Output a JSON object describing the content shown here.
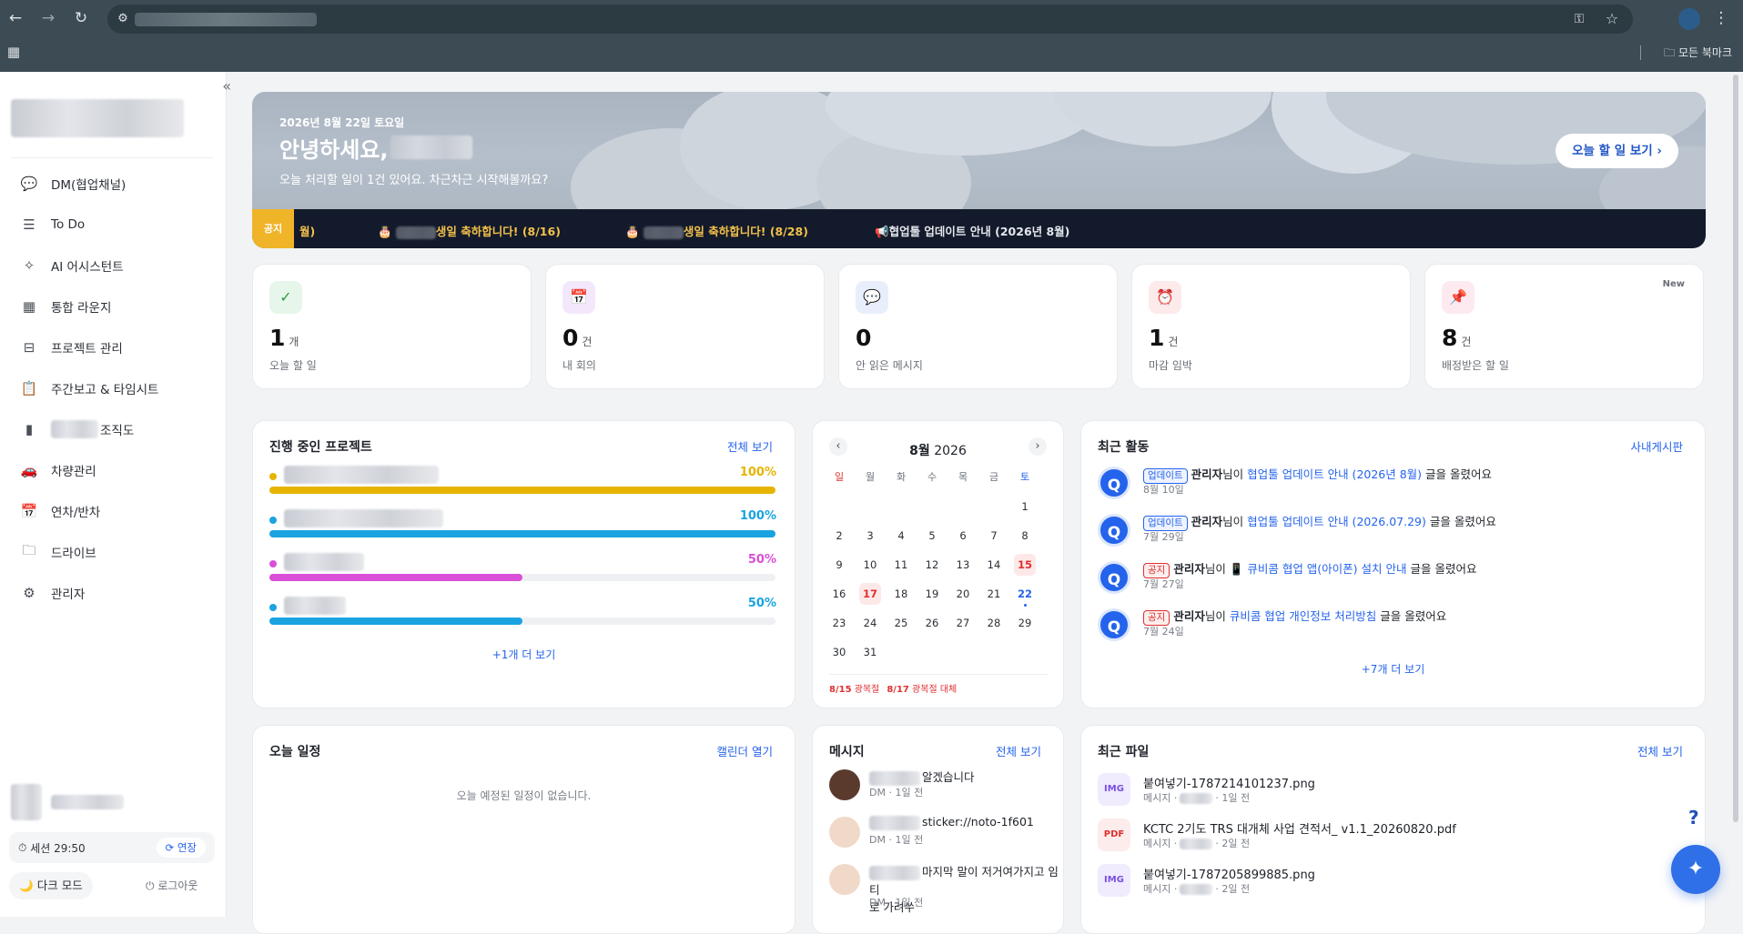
{
  "browser": {
    "bookmarks_label": "모든 북마크"
  },
  "sidebar": {
    "items": [
      {
        "label": "DM(협업채널)",
        "icon": "chat-icon"
      },
      {
        "label": "To Do",
        "icon": "list-icon"
      },
      {
        "label": "AI 어시스턴트",
        "icon": "sparkle-icon"
      },
      {
        "label": "통합 라운지",
        "icon": "grid-icon"
      },
      {
        "label": "프로젝트 관리",
        "icon": "project-icon"
      },
      {
        "label": "주간보고 & 타임시트",
        "icon": "clipboard-icon"
      },
      {
        "label": "조직도",
        "icon": "org-icon"
      },
      {
        "label": "차량관리",
        "icon": "car-icon"
      },
      {
        "label": "연차/반차",
        "icon": "calendar-icon"
      },
      {
        "label": "드라이브",
        "icon": "folder-icon"
      },
      {
        "label": "관리자",
        "icon": "gear-icon"
      }
    ],
    "session": "세션 29:50",
    "extend": "연장",
    "dark_mode": "다크 모드",
    "logout": "로그아웃"
  },
  "hero": {
    "date": "2026년 8월 22일 토요일",
    "greeting": "안녕하세요,",
    "subtitle": "오늘 처리할 일이 1건 있어요. 차근차근 시작해볼까요?",
    "today_button": "오늘 할 일 보기 ›"
  },
  "notice": {
    "tag": "공지",
    "items": [
      "월)",
      "생일 축하합니다! (8/16)",
      "생일 축하합니다! (8/28)",
      "협업툴 업데이트 안내 (2026년 8월)"
    ]
  },
  "stats": [
    {
      "icon": "✓",
      "num": "1",
      "unit": "개",
      "label": "오늘 할 일",
      "bg": "#e6f6ea",
      "color": "#2f9e44"
    },
    {
      "icon": "📅",
      "num": "0",
      "unit": "건",
      "label": "내 회의",
      "bg": "#f3e8fb",
      "color": "#a04cd9"
    },
    {
      "icon": "💬",
      "num": "0",
      "unit": "",
      "label": "안 읽은 메시지",
      "bg": "#e8eefc",
      "color": "#2563eb"
    },
    {
      "icon": "⏰",
      "num": "1",
      "unit": "건",
      "label": "마감 임박",
      "bg": "#fdeaea",
      "color": "#e03131"
    },
    {
      "icon": "📌",
      "num": "8",
      "unit": "건",
      "label": "배정받은 할 일",
      "bg": "#fdeaf0",
      "color": "#d6336c",
      "badge": "New"
    }
  ],
  "projects": {
    "title": "진행 중인 프로젝트",
    "link": "전체 보기",
    "items": [
      {
        "pct": "100%",
        "value": 1.0,
        "color": "#e6b400"
      },
      {
        "pct": "100%",
        "value": 1.0,
        "color": "#1aa3e0"
      },
      {
        "pct": "50%",
        "value": 0.5,
        "color": "#d94fd8"
      },
      {
        "pct": "50%",
        "value": 0.5,
        "color": "#1aa3e0"
      }
    ],
    "more": "+1개 더 보기"
  },
  "calendar": {
    "month": "8월",
    "year": "2026",
    "weekdays": [
      "일",
      "월",
      "화",
      "수",
      "목",
      "금",
      "토"
    ],
    "holidays": [
      {
        "date": "8/15",
        "label": "광복절"
      },
      {
        "date": "8/17",
        "label": "광복절 대체"
      }
    ]
  },
  "activity": {
    "title": "최근 활동",
    "link": "사내게시판",
    "items": [
      {
        "badge": "업데이트",
        "author": "관리자",
        "mid": "님이 ",
        "target": "협업툴 업데이트 안내 (2026년 8월)",
        "tail": " 글을 올렸어요",
        "date": "8월 10일"
      },
      {
        "badge": "업데이트",
        "author": "관리자",
        "mid": "님이 ",
        "target": "협업툴 업데이트 안내 (2026.07.29)",
        "tail": " 글을 올렸어요",
        "date": "7월 29일"
      },
      {
        "badge": "공지",
        "author": "관리자",
        "mid": "님이 📱 ",
        "target": "큐비콤 협업 앱(아이폰) 설치 안내",
        "tail": " 글을 올렸어요",
        "date": "7월 27일"
      },
      {
        "badge": "공지",
        "author": "관리자",
        "mid": "님이 ",
        "target": "큐비콤 협업 개인정보 처리방침",
        "tail": " 글을 올렸어요",
        "date": "7월 24일"
      }
    ],
    "more": "+7개 더 보기"
  },
  "schedule": {
    "title": "오늘 일정",
    "link": "캘린더 열기",
    "empty": "오늘 예정된 일정이 없습니다."
  },
  "messages": {
    "title": "메시지",
    "link": "전체 보기",
    "items": [
      {
        "text": "알겠습니다",
        "meta": "DM · 1일 전"
      },
      {
        "text": "sticker://noto-1f601",
        "meta": "DM · 1일 전"
      },
      {
        "text": "마지막 말이 저거여가지고 임티",
        "text2": "로 가려쑤",
        "meta": "DM · 1일 전"
      }
    ]
  },
  "files": {
    "title": "최근 파일",
    "link": "전체 보기",
    "items": [
      {
        "type": "IMG",
        "name": "붙여넣기-1787214101237.png",
        "meta_a": "메시지 ·",
        "meta_b": "· 1일 전"
      },
      {
        "type": "PDF",
        "name": "KCTC 2기도 TRS 대개체 사업 견적서_ v1.1_20260820.pdf",
        "meta_a": "메시지 ·",
        "meta_b": "· 2일 전"
      },
      {
        "type": "IMG",
        "name": "붙여넣기-1787205899885.png",
        "meta_a": "메시지 ·",
        "meta_b": "· 2일 전"
      }
    ]
  },
  "help": "?"
}
